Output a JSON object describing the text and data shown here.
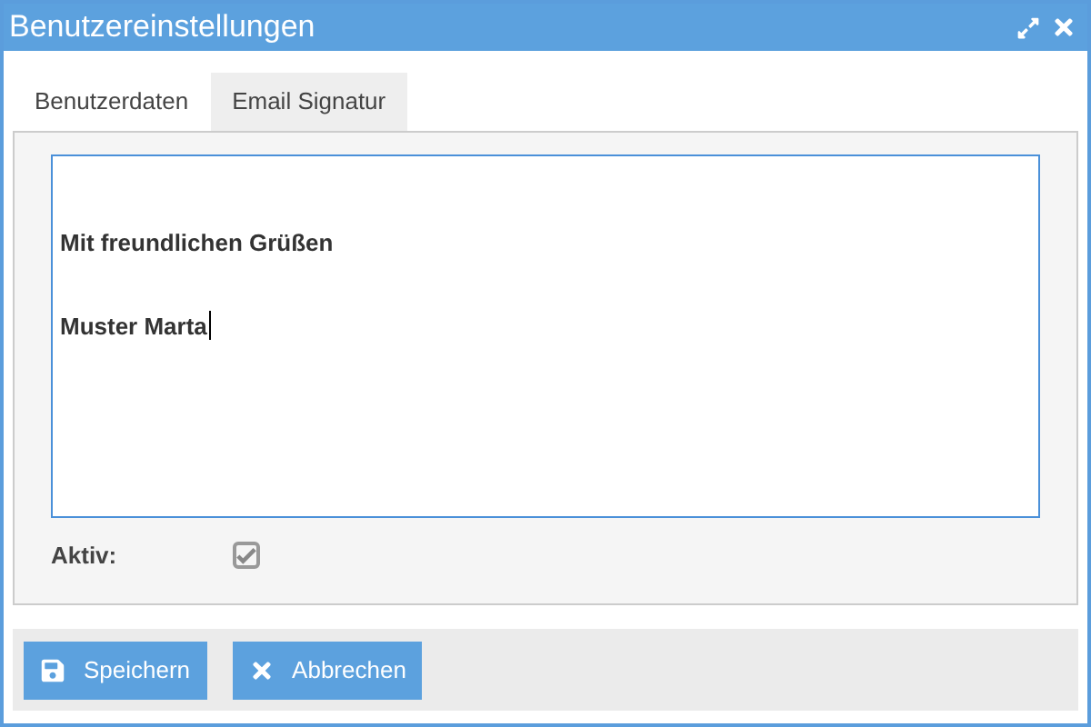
{
  "window": {
    "title": "Benutzereinstellungen"
  },
  "tabs": [
    {
      "label": "Benutzerdaten",
      "selected": false
    },
    {
      "label": "Email Signatur",
      "selected": true
    }
  ],
  "signature": {
    "lines": [
      "Mit freundlichen Grüßen",
      "Muster Marta"
    ],
    "focused": true
  },
  "active": {
    "label": "Aktiv:",
    "checked": true,
    "disabled": true
  },
  "buttons": [
    {
      "label": "Speichern",
      "kind": "save"
    },
    {
      "label": "Abbrechen",
      "kind": "cancel"
    }
  ]
}
